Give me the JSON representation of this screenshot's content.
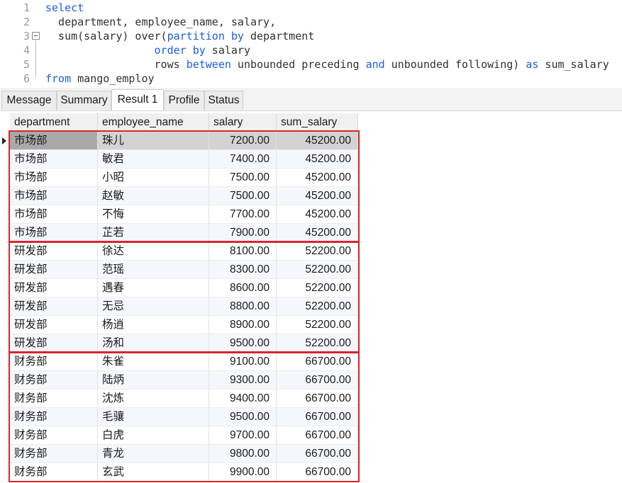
{
  "editor": {
    "lines": [
      {
        "num": "1",
        "tokens": [
          {
            "t": "select",
            "kw": true
          }
        ]
      },
      {
        "num": "2",
        "tokens": [
          {
            "t": "  department, employee_name, salary,",
            "kw": false
          }
        ]
      },
      {
        "num": "3",
        "tokens": [
          {
            "t": "  sum(salary) over(",
            "kw": false
          },
          {
            "t": "partition",
            "kw": true
          },
          {
            "t": " ",
            "kw": false
          },
          {
            "t": "by",
            "kw": true
          },
          {
            "t": " department",
            "kw": false
          }
        ]
      },
      {
        "num": "4",
        "tokens": [
          {
            "t": "                 ",
            "kw": false
          },
          {
            "t": "order",
            "kw": true
          },
          {
            "t": " ",
            "kw": false
          },
          {
            "t": "by",
            "kw": true
          },
          {
            "t": " salary",
            "kw": false
          }
        ]
      },
      {
        "num": "5",
        "tokens": [
          {
            "t": "                 rows ",
            "kw": false
          },
          {
            "t": "between",
            "kw": true
          },
          {
            "t": " unbounded preceding ",
            "kw": false
          },
          {
            "t": "and",
            "kw": true
          },
          {
            "t": " unbounded following) ",
            "kw": false
          },
          {
            "t": "as",
            "kw": true
          },
          {
            "t": " sum_salary",
            "kw": false
          }
        ]
      },
      {
        "num": "6",
        "tokens": [
          {
            "t": "from",
            "kw": true
          },
          {
            "t": " mango_employ",
            "kw": false
          }
        ]
      }
    ],
    "keyword_color": "#1c5ee0"
  },
  "tabs": [
    {
      "label": "Message",
      "active": false
    },
    {
      "label": "Summary",
      "active": false
    },
    {
      "label": "Result 1",
      "active": true
    },
    {
      "label": "Profile",
      "active": false
    },
    {
      "label": "Status",
      "active": false
    }
  ],
  "grid": {
    "columns": [
      "department",
      "employee_name",
      "salary",
      "sum_salary"
    ],
    "rows": [
      [
        "市场部",
        "珠儿",
        "7200.00",
        "45200.00"
      ],
      [
        "市场部",
        "敏君",
        "7400.00",
        "45200.00"
      ],
      [
        "市场部",
        "小昭",
        "7500.00",
        "45200.00"
      ],
      [
        "市场部",
        "赵敏",
        "7500.00",
        "45200.00"
      ],
      [
        "市场部",
        "不悔",
        "7700.00",
        "45200.00"
      ],
      [
        "市场部",
        "芷若",
        "7900.00",
        "45200.00"
      ],
      [
        "研发部",
        "徐达",
        "8100.00",
        "52200.00"
      ],
      [
        "研发部",
        "范瑶",
        "8300.00",
        "52200.00"
      ],
      [
        "研发部",
        "遇春",
        "8600.00",
        "52200.00"
      ],
      [
        "研发部",
        "无忌",
        "8800.00",
        "52200.00"
      ],
      [
        "研发部",
        "杨逍",
        "8900.00",
        "52200.00"
      ],
      [
        "研发部",
        "汤和",
        "9500.00",
        "52200.00"
      ],
      [
        "财务部",
        "朱雀",
        "9100.00",
        "66700.00"
      ],
      [
        "财务部",
        "陆炳",
        "9300.00",
        "66700.00"
      ],
      [
        "财务部",
        "沈炼",
        "9400.00",
        "66700.00"
      ],
      [
        "财务部",
        "毛骧",
        "9500.00",
        "66700.00"
      ],
      [
        "财务部",
        "白虎",
        "9700.00",
        "66700.00"
      ],
      [
        "财务部",
        "青龙",
        "9800.00",
        "66700.00"
      ],
      [
        "财务部",
        "玄武",
        "9900.00",
        "66700.00"
      ]
    ],
    "selected_row": 0,
    "highlight_groups": [
      [
        0,
        5
      ],
      [
        6,
        11
      ],
      [
        12,
        18
      ]
    ],
    "highlight_color": "#d9252e",
    "row_stripe_color": "#f4f8fd",
    "selected_row_color": "#d3d3d3"
  }
}
